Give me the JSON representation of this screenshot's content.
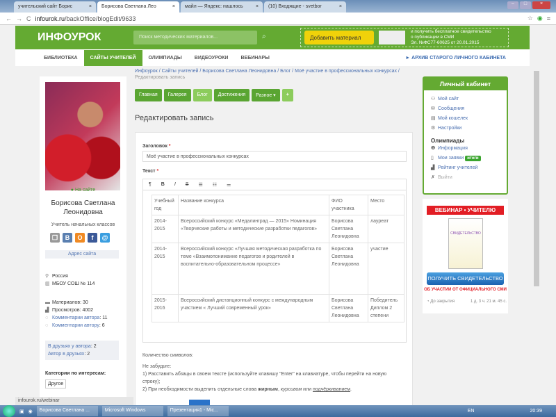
{
  "browser": {
    "tabs": [
      "учительский сайт Борис",
      "Борисова Светлана Лео",
      "майл — Яндекс: нашлось",
      "(10) Входящие - svetbor"
    ],
    "url_domain": "infourok.ru",
    "url_path": "/backOffice/blogEdit/9633"
  },
  "header": {
    "logo": "ИНФОУРОК",
    "search_placeholder": "Поиск методических материалов...",
    "add_button": "Добавить материал",
    "promo_lines": [
      "и получить бесплатное свидетельство",
      "о публикации в СМИ",
      "Эл. №ФС77-60625 от 20.01.2015"
    ]
  },
  "nav": {
    "items": [
      "БИБЛИОТЕКА",
      "САЙТЫ УЧИТЕЛЕЙ",
      "ОЛИМПИАДЫ",
      "ВИДЕОУРОКИ",
      "ВЕБИНАРЫ"
    ],
    "archive": "► АРХИВ СТАРОГО ЛИЧНОГО КАБИНЕТА"
  },
  "profile": {
    "online": "На сайте",
    "name": "Борисова Светлана Леонидовна",
    "role": "Учитель начальных классов",
    "site_address": "Адрес сайта",
    "country": "Россия",
    "school": "МБОУ СОШ № 114",
    "materials": "Материалов: 30",
    "views": "Просмотров: 4002",
    "comments_by_label": "Комментарии автора",
    "comments_by": ": 11",
    "comments_to_label": "Комментарии автору",
    "comments_to": ": 6",
    "friends_of_label": "В друзьях у автора",
    "friends_of": ": 2",
    "in_friends_label": "Автор в друзьях",
    "in_friends": ": 2",
    "categories_title": "Категории по интересам:",
    "category": "Другое"
  },
  "breadcrumbs": [
    "Инфоурок",
    "Сайты учителей",
    "Борисова Светлана Леонидовна",
    "Блог",
    "Моё участие в профессиональных конкурсах"
  ],
  "breadcrumb_current": "Редактировать запись",
  "site_tabs": [
    "Главная",
    "Галерея",
    "Блог",
    "Достижения",
    "Разное ▾",
    "+"
  ],
  "page_title": "Редактировать запись",
  "form": {
    "title_label": "Заголовок",
    "title_value": "Моё участие в профессиональных конкурсах",
    "text_label": "Текст",
    "required": "*",
    "toolbar": [
      "¶",
      "B",
      "I",
      "S",
      "☰",
      "☷",
      "⚌"
    ],
    "table": {
      "headers": [
        "Учебный год",
        "Название конкурса",
        "ФИО участника",
        "Место"
      ],
      "rows": [
        [
          "2014-2015",
          "Всероссийский конкурс «Медалинград — 2015» Номинация «Творческие работы и методические разработки педагогов»",
          "Борисова Светлана Леонидовна",
          "лауреат"
        ],
        [
          "2014-2015",
          "Всероссийский конкурс «Лучшая методическая разработка по теме «Взаимопонимание педагогов и родителей в воспитательно-образовательном процессе»",
          "Борисова Светлана Леонидовна",
          "участие"
        ],
        [
          "2015-2016",
          "Всероссийский дистанционный конкурс с международным участием « Лучший современный урок»",
          "Борисова Светлана Леонидовна",
          "Победитель Диплом 2 степени"
        ]
      ]
    },
    "char_count": "Количество символов:",
    "remember": "Не забудьте:",
    "tip1": "1) Расставить абзацы в своем тексте (используйте клавишу \"Enter\" на клавиатуре, чтобы перейти на новую строку);",
    "tip2_a": "2) При необходимости выделить отдельные слова ",
    "tip2_bold": "жирным",
    "tip2_b": ", ",
    "tip2_italic": "курсивом",
    "tip2_c": " или ",
    "tip2_under": "подчёркиванием",
    "tip2_d": "."
  },
  "cabinet": {
    "title": "Личный кабинет",
    "items": [
      "Мой сайт",
      "Сообщения",
      "Мой кошелек",
      "Настройки"
    ],
    "olymp_title": "Олимпиады",
    "olymp_items": [
      "Информация",
      "Мои заявки",
      "Рейтинг учителей",
      "Выйти"
    ],
    "badge": "итоги"
  },
  "ad": {
    "webinar": "ВЕБИНАР • УЧИТЕЛЮ",
    "cert": "СВИДЕТЕЛЬСТВО",
    "button": "ПОЛУЧИТЬ СВИДЕТЕЛЬСТВО",
    "subtitle": "ОБ УЧАСТИИ ОТ ОФИЦИАЛЬНОГО СМИ",
    "timer_label": "До закрытия",
    "timer": "1 д. 3 ч. 21 м. 45 с."
  },
  "status_url": "infourok.ru/webinar",
  "taskbar": {
    "items": [
      "Борисова Светлана ...",
      "Microsoft Windows",
      "Презентация1 - Mic..."
    ],
    "lang": "EN",
    "time": "20:39"
  }
}
